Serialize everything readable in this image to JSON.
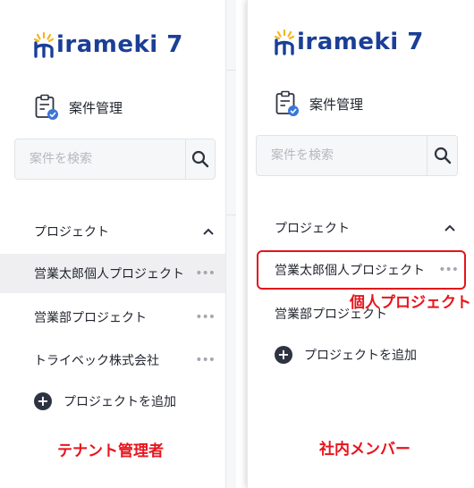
{
  "app": {
    "logo_text": "irameki 7",
    "colors": {
      "brand": "#1b3f96",
      "logo_accent": "#f2b51e",
      "annotation": "#e8141c"
    }
  },
  "left_panel": {
    "case_management_label": "案件管理",
    "search": {
      "placeholder": "案件を検索",
      "value": ""
    },
    "section_label": "プロジェクト",
    "projects": [
      {
        "label": "営業太郎個人プロジェクト",
        "more": "•••",
        "selected": true
      },
      {
        "label": "営業部プロジェクト",
        "more": "•••",
        "selected": false
      },
      {
        "label": "トライベック株式会社",
        "more": "•••",
        "selected": false
      }
    ],
    "add_project_label": "プロジェクトを追加",
    "caption": "テナント管理者"
  },
  "right_panel": {
    "case_management_label": "案件管理",
    "search": {
      "placeholder": "案件を検索",
      "value": ""
    },
    "section_label": "プロジェクト",
    "projects": [
      {
        "label": "営業太郎個人プロジェクト",
        "more": "•••",
        "selected": false
      },
      {
        "label": "営業部プロジェクト",
        "more": "",
        "selected": false
      }
    ],
    "add_project_label": "プロジェクトを追加",
    "highlight_caption": "個人プロジェクト",
    "caption": "社内メンバー"
  }
}
